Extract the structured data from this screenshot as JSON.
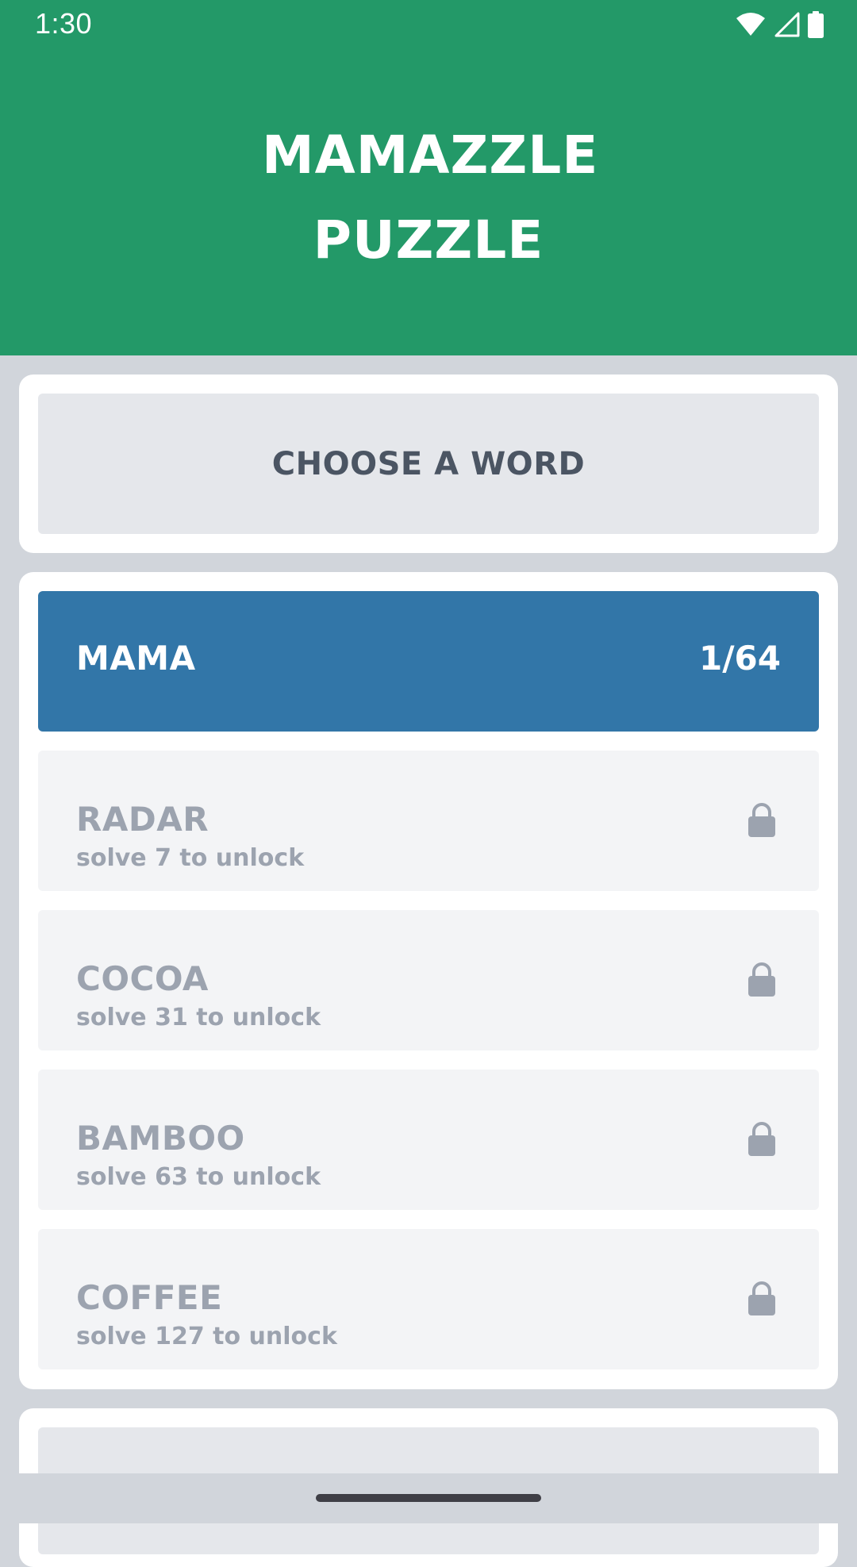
{
  "status_bar": {
    "time": "1:30",
    "icons": [
      "wifi-icon",
      "signal-icon",
      "battery-icon"
    ]
  },
  "header": {
    "title": "MAMAZZLE PUZZLE",
    "background_color": "#239968"
  },
  "choose": {
    "label": "CHOOSE A WORD"
  },
  "words": [
    {
      "name": "MAMA",
      "progress": "1/64",
      "locked": false
    },
    {
      "name": "RADAR",
      "hint": "solve 7 to unlock",
      "locked": true
    },
    {
      "name": "COCOA",
      "hint": "solve 31 to unlock",
      "locked": true
    },
    {
      "name": "BAMBOO",
      "hint": "solve 63 to unlock",
      "locked": true
    },
    {
      "name": "COFFEE",
      "hint": "solve 127 to unlock",
      "locked": true
    }
  ],
  "colors": {
    "accent": "#239968",
    "active_item": "#3276a8",
    "locked_text": "#9ca3af",
    "page_background": "#d1d5db"
  }
}
